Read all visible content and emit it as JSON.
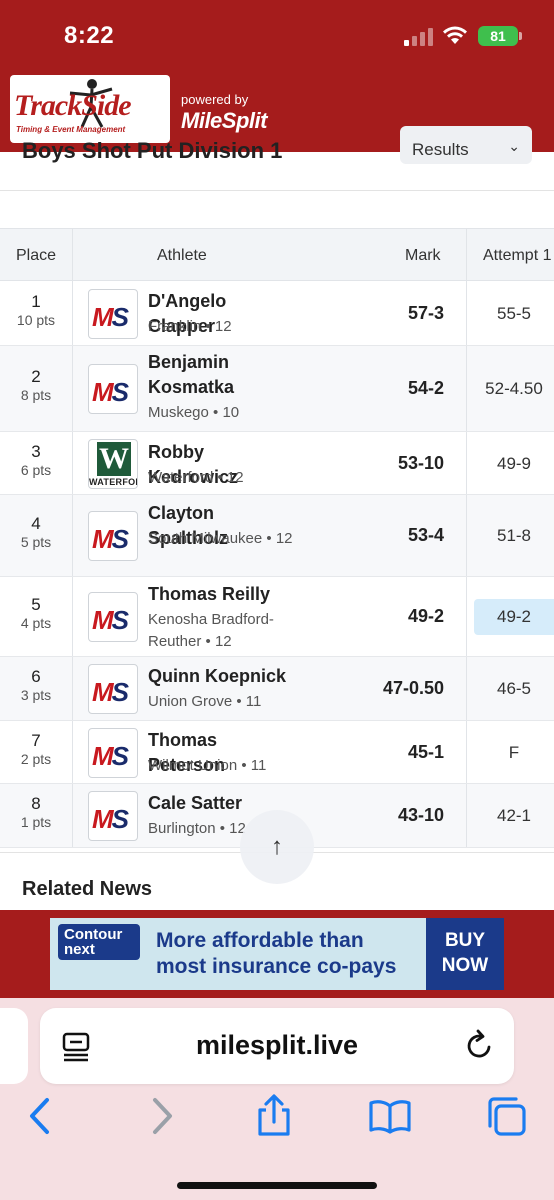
{
  "status_bar": {
    "time": "8:22",
    "battery": "81"
  },
  "header": {
    "logo_main": "TrackSide",
    "logo_sub": "Timing & Event Management",
    "powered_by": "powered by",
    "brand": "MileSplit"
  },
  "event": {
    "title": "Boys Shot Put Division 1",
    "filter_value": "Results"
  },
  "table": {
    "columns": {
      "place": "Place",
      "athlete": "Athlete",
      "mark": "Mark",
      "attempt": "Attempt 1"
    },
    "rows": [
      {
        "place": "1",
        "pts": "10 pts",
        "name": "D'Angelo Clapper",
        "team": "Franklin • 12",
        "mark": "57-3",
        "attempt": "55-5",
        "logo": "MS"
      },
      {
        "place": "2",
        "pts": "8 pts",
        "name": "Benjamin Kosmatka",
        "team": "Muskego • 10",
        "mark": "54-2",
        "attempt": "52-4.50",
        "logo": "MS"
      },
      {
        "place": "3",
        "pts": "6 pts",
        "name": "Robby Kedrowicz",
        "team": "Waterford • 12",
        "mark": "53-10",
        "attempt": "49-9",
        "logo": "W",
        "logo_text": "WATERFOR"
      },
      {
        "place": "4",
        "pts": "5 pts",
        "name": "Clayton Spaltholz",
        "team": "South Milwaukee • 12",
        "mark": "53-4",
        "attempt": "51-8",
        "logo": "MS"
      },
      {
        "place": "5",
        "pts": "4 pts",
        "name": "Thomas Reilly",
        "team": "Kenosha Bradford-Reuther • 12",
        "mark": "49-2",
        "attempt": "49-2",
        "logo": "MS"
      },
      {
        "place": "6",
        "pts": "3 pts",
        "name": "Quinn Koepnick",
        "team": "Union Grove • 11",
        "mark": "47-0.50",
        "attempt": "46-5",
        "logo": "MS"
      },
      {
        "place": "7",
        "pts": "2 pts",
        "name": "Thomas Peterson",
        "team": "Wilmot Union • 11",
        "mark": "45-1",
        "attempt": "F",
        "logo": "MS"
      },
      {
        "place": "8",
        "pts": "1 pts",
        "name": "Cale Satter",
        "team": "Burlington • 12",
        "mark": "43-10",
        "attempt": "42-1",
        "logo": "MS"
      }
    ]
  },
  "related_news": "Related News",
  "ad": {
    "logo": "Contour next",
    "line1": "More affordable than",
    "line2": "most insurance co-pays",
    "cta1": "BUY",
    "cta2": "NOW"
  },
  "browser": {
    "url": "milesplit.live"
  },
  "colors": {
    "brand_red": "#a51c1c",
    "ms_red": "#c8191f",
    "ms_navy": "#1a2b6b",
    "best_highlight": "#d6ecfa",
    "ios_blue": "#1a7cf0"
  }
}
